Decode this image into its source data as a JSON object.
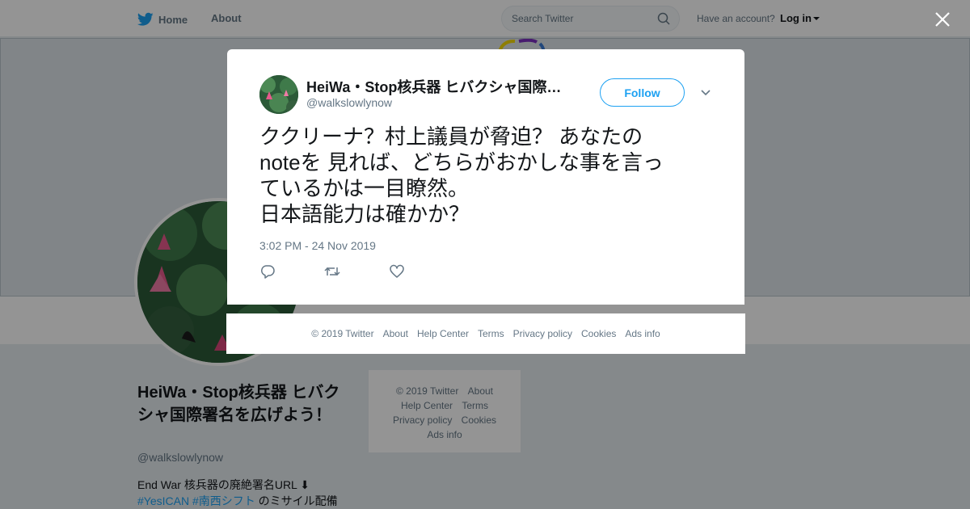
{
  "topbar": {
    "home_label": "Home",
    "about_label": "About",
    "search_placeholder": "Search Twitter",
    "account_prompt": "Have an account?",
    "login_label": "Log in"
  },
  "profile": {
    "name": "HeiWa・Stop核兵器 ヒバクシャ国際署名を広げよう！",
    "handle": "@walkslowlynow",
    "bio_line1": "End War 核兵器の廃絶署名URL ⬇",
    "bio_tag1": "#YesICAN",
    "bio_tag2": "#南西シフト",
    "bio_rest": " のミサイル配備"
  },
  "side_footer": {
    "copyright": "© 2019 Twitter",
    "about": "About",
    "help": "Help Center",
    "terms": "Terms",
    "privacy": "Privacy policy",
    "cookies": "Cookies",
    "ads": "Ads info"
  },
  "tweet": {
    "author_name": "HeiWa・Stop核兵器 ヒバクシャ国際署名を広げよう！",
    "author_handle": "@walkslowlynow",
    "follow_label": "Follow",
    "text": "ククリーナ？村上議員が脅迫？ あなたの\nnoteを 見れば、どちらがおかしな事を言っ\nているかは一目瞭然。\n日本語能力は確かか？",
    "timestamp": "3:02 PM - 24 Nov 2019"
  },
  "modal_footer": {
    "copyright": "© 2019 Twitter",
    "about": "About",
    "help": "Help Center",
    "terms": "Terms",
    "privacy": "Privacy policy",
    "cookies": "Cookies",
    "ads": "Ads info"
  },
  "colors": {
    "accent": "#1da1f2",
    "text_primary": "#14171a",
    "text_secondary": "#657786",
    "page_background": "#e6ecf0"
  },
  "icons": {
    "logo": "twitter-bird-icon",
    "search": "search-icon",
    "close": "close-icon",
    "menu": "chevron-down-icon",
    "reply": "reply-icon",
    "retweet": "retweet-icon",
    "like": "heart-icon"
  }
}
